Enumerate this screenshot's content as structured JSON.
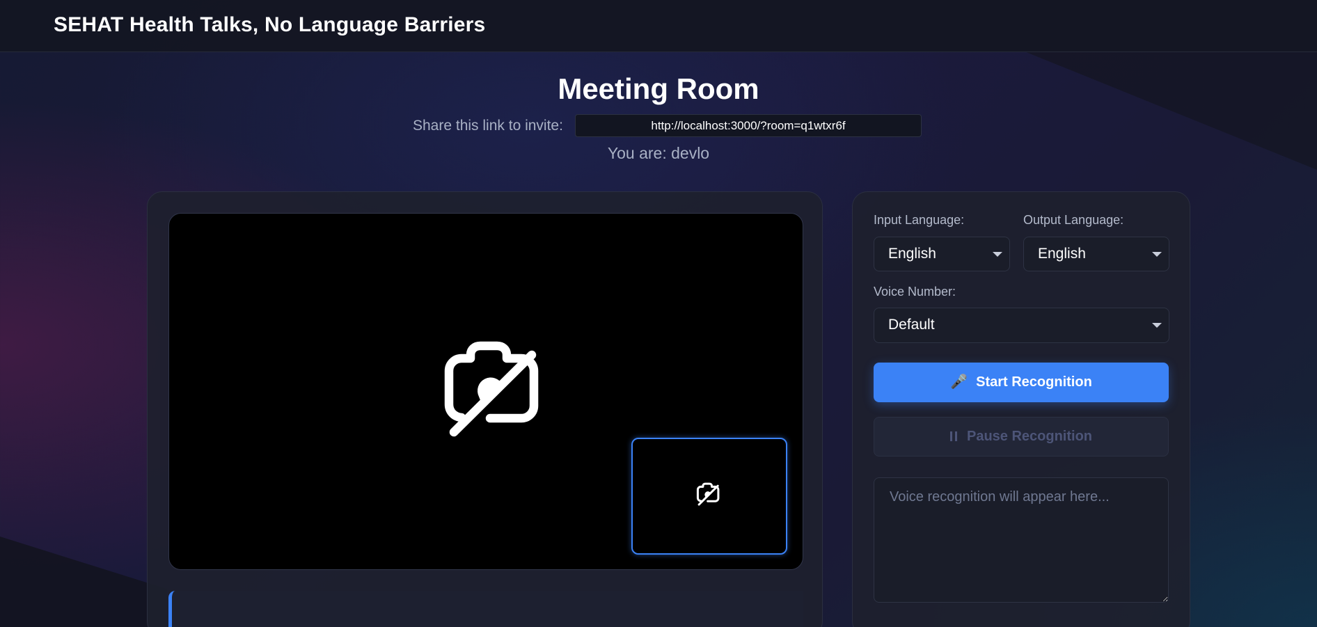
{
  "header": {
    "app_title": "SEHAT Health Talks, No Language Barriers"
  },
  "meeting": {
    "title": "Meeting Room",
    "share_label": "Share this link to invite:",
    "share_link": "http://localhost:3000/?room=q1wtxr6f",
    "you_are": "You are: devlo"
  },
  "video": {
    "main_icon": "camera-off-icon",
    "pip_icon": "camera-off-icon"
  },
  "controls": {
    "input_language_label": "Input Language:",
    "input_language_value": "English",
    "output_language_label": "Output Language:",
    "output_language_value": "English",
    "voice_number_label": "Voice Number:",
    "voice_number_value": "Default",
    "start_icon": "🎤",
    "start_label": "Start Recognition",
    "pause_label": "Pause Recognition",
    "recognition_placeholder": "Voice recognition will appear here..."
  },
  "colors": {
    "accent": "#3b82f6",
    "background": "#1b1a3c",
    "panel": "#1e202d"
  }
}
